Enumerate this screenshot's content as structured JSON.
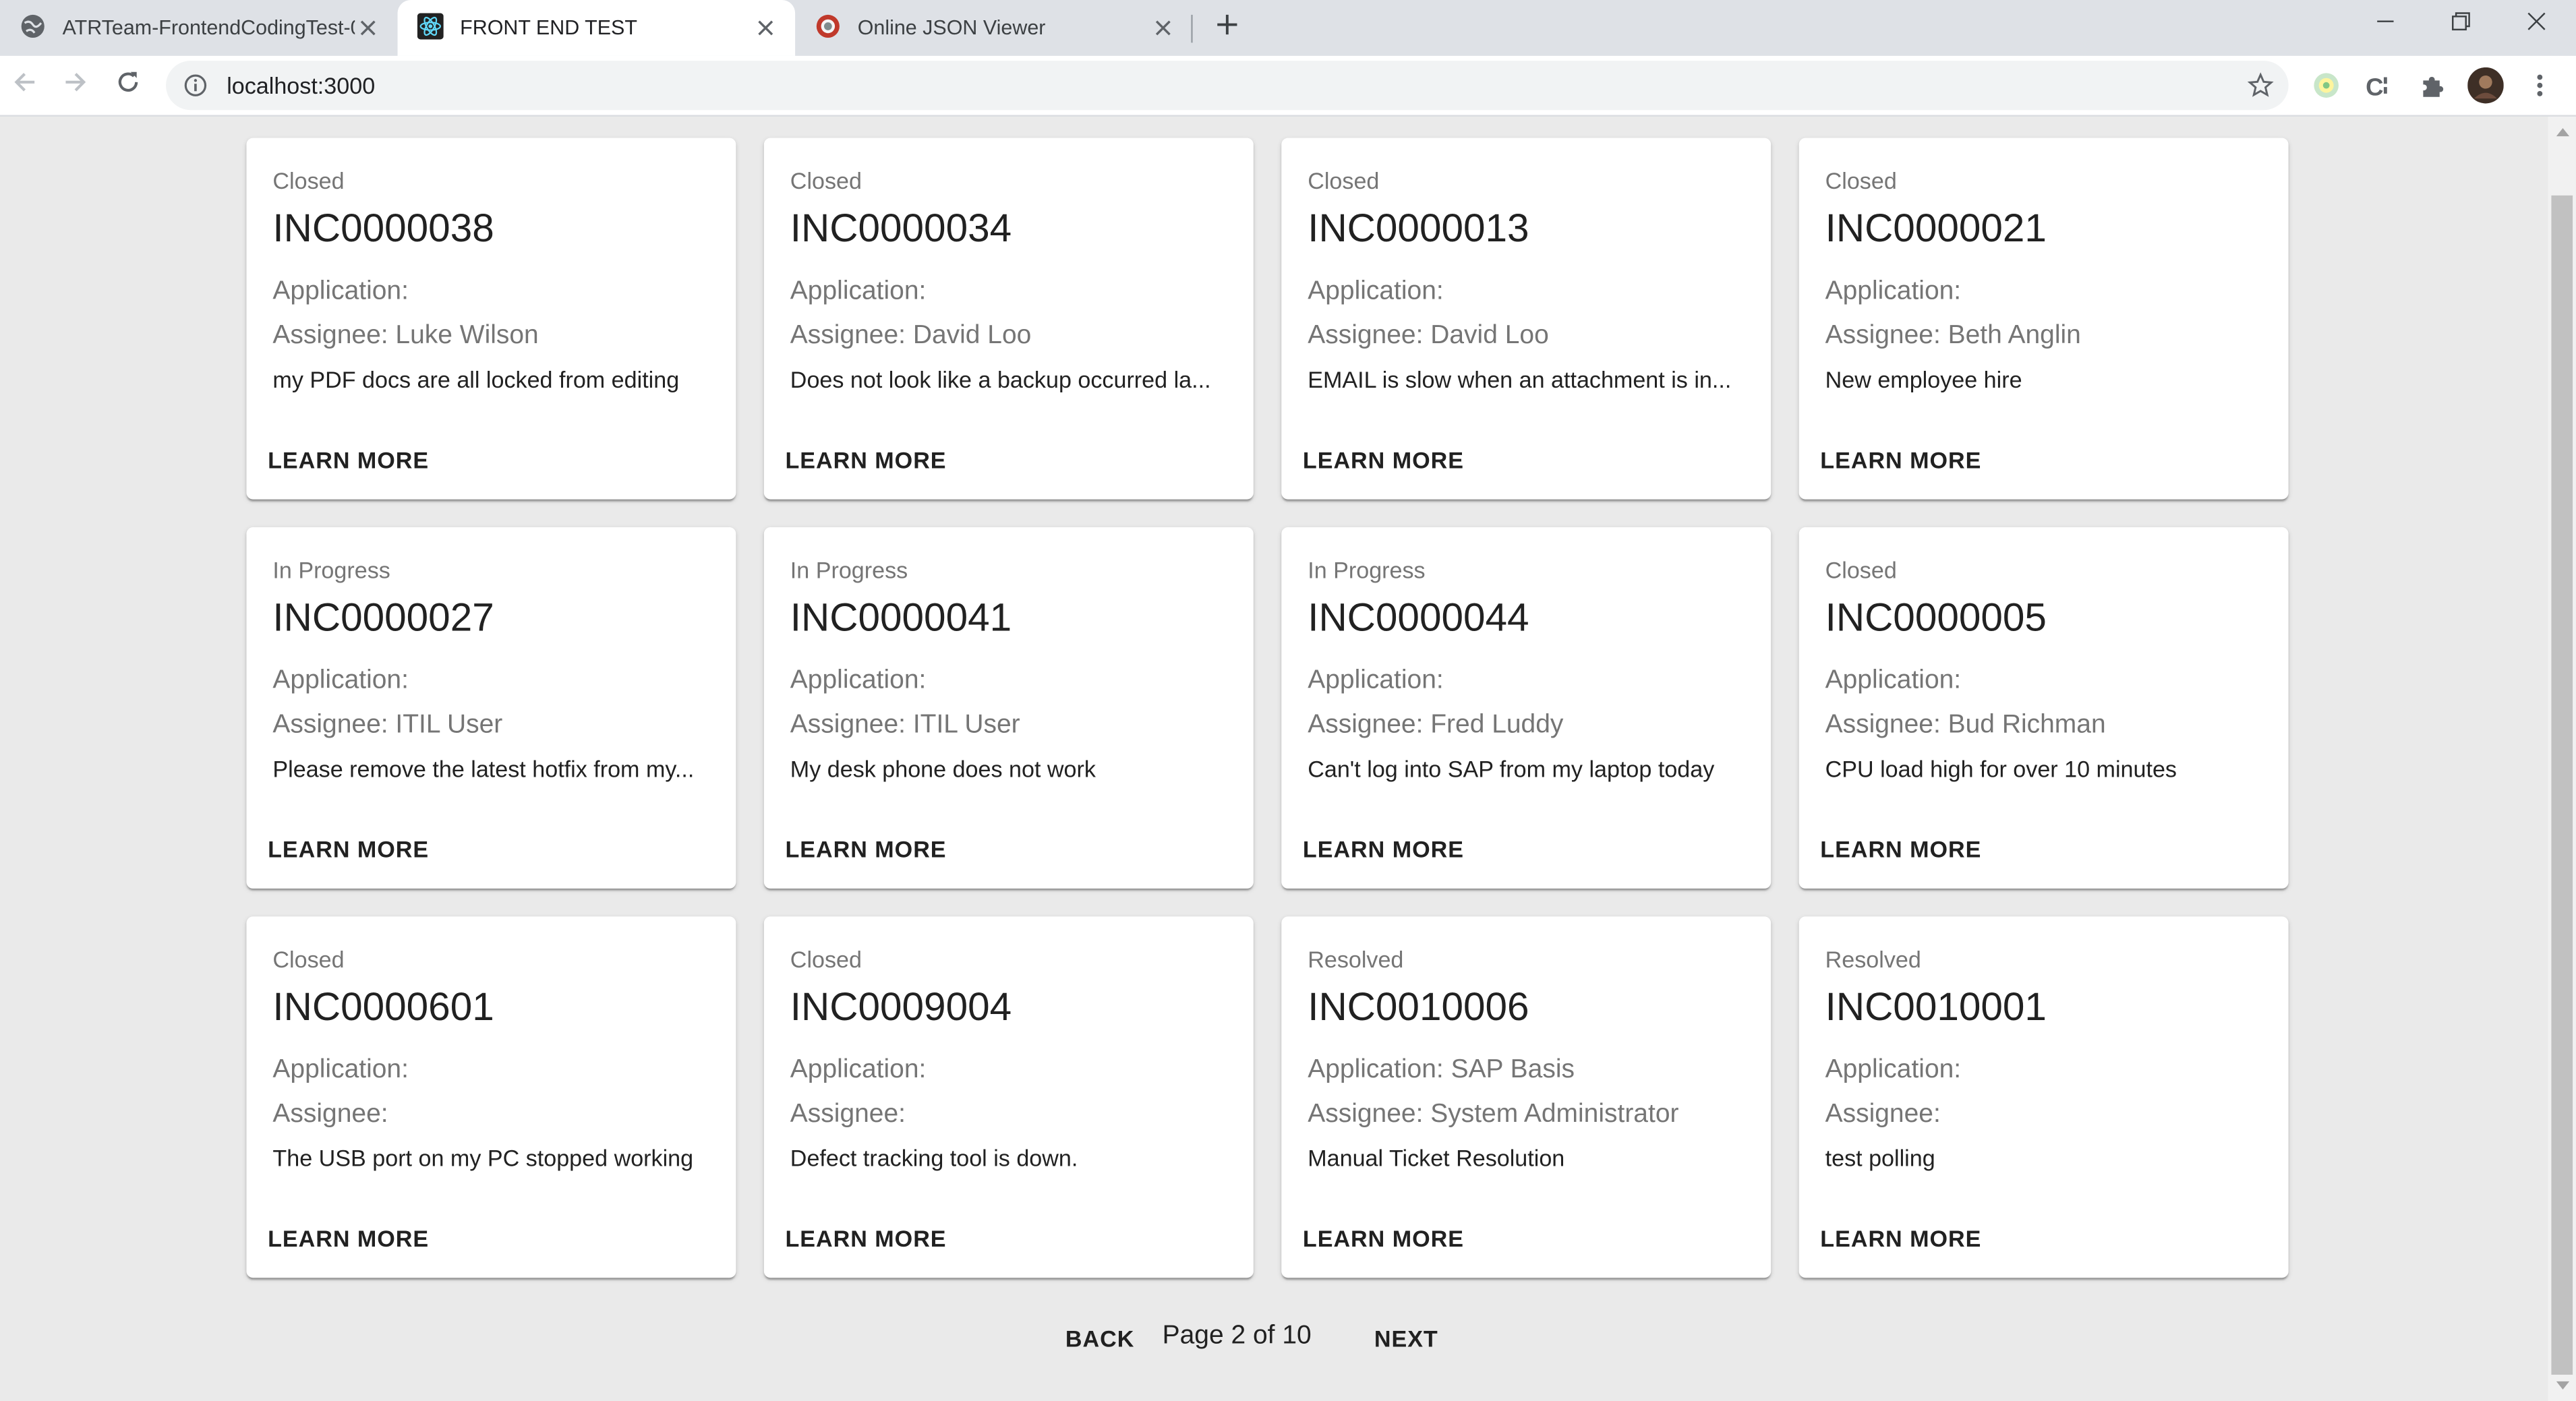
{
  "browser": {
    "tabs": [
      {
        "title": "ATRTeam-FrontendCodingTest-0",
        "icon": "globe-icon"
      },
      {
        "title": "FRONT END TEST",
        "icon": "react-icon"
      },
      {
        "title": "Online JSON Viewer",
        "icon": "json-viewer-icon"
      }
    ],
    "url": "localhost:3000"
  },
  "cards": [
    {
      "status": "Closed",
      "number": "INC0000038",
      "application": "Application:",
      "assignee": "Assignee: Luke Wilson",
      "description": "my PDF docs are all locked from editing",
      "action": "LEARN MORE"
    },
    {
      "status": "Closed",
      "number": "INC0000034",
      "application": "Application:",
      "assignee": "Assignee: David Loo",
      "description": "Does not look like a backup occurred la...",
      "action": "LEARN MORE"
    },
    {
      "status": "Closed",
      "number": "INC0000013",
      "application": "Application:",
      "assignee": "Assignee: David Loo",
      "description": "EMAIL is slow when an attachment is in...",
      "action": "LEARN MORE"
    },
    {
      "status": "Closed",
      "number": "INC0000021",
      "application": "Application:",
      "assignee": "Assignee: Beth Anglin",
      "description": "New employee hire",
      "action": "LEARN MORE"
    },
    {
      "status": "In Progress",
      "number": "INC0000027",
      "application": "Application:",
      "assignee": "Assignee: ITIL User",
      "description": "Please remove the latest hotfix from my...",
      "action": "LEARN MORE"
    },
    {
      "status": "In Progress",
      "number": "INC0000041",
      "application": "Application:",
      "assignee": "Assignee: ITIL User",
      "description": "My desk phone does not work",
      "action": "LEARN MORE"
    },
    {
      "status": "In Progress",
      "number": "INC0000044",
      "application": "Application:",
      "assignee": "Assignee: Fred Luddy",
      "description": "Can't log into SAP from my laptop today",
      "action": "LEARN MORE"
    },
    {
      "status": "Closed",
      "number": "INC0000005",
      "application": "Application:",
      "assignee": "Assignee: Bud Richman",
      "description": "CPU load high for over 10 minutes",
      "action": "LEARN MORE"
    },
    {
      "status": "Closed",
      "number": "INC0000601",
      "application": "Application:",
      "assignee": "Assignee:",
      "description": "The USB port on my PC stopped working",
      "action": "LEARN MORE"
    },
    {
      "status": "Closed",
      "number": "INC0009004",
      "application": "Application:",
      "assignee": "Assignee:",
      "description": "Defect tracking tool is down.",
      "action": "LEARN MORE"
    },
    {
      "status": "Resolved",
      "number": "INC0010006",
      "application": "Application: SAP Basis",
      "assignee": "Assignee: System Administrator",
      "description": "Manual Ticket Resolution",
      "action": "LEARN MORE"
    },
    {
      "status": "Resolved",
      "number": "INC0010001",
      "application": "Application:",
      "assignee": "Assignee:",
      "description": "test polling",
      "action": "LEARN MORE"
    }
  ],
  "pagination": {
    "back_label": "BACK",
    "page_label": "Page 2 of 10",
    "next_label": "NEXT"
  },
  "colors": {
    "page_background": "#eaeaea",
    "card_background": "#ffffff",
    "secondary_text": "#757575",
    "primary_text": "#212121"
  }
}
